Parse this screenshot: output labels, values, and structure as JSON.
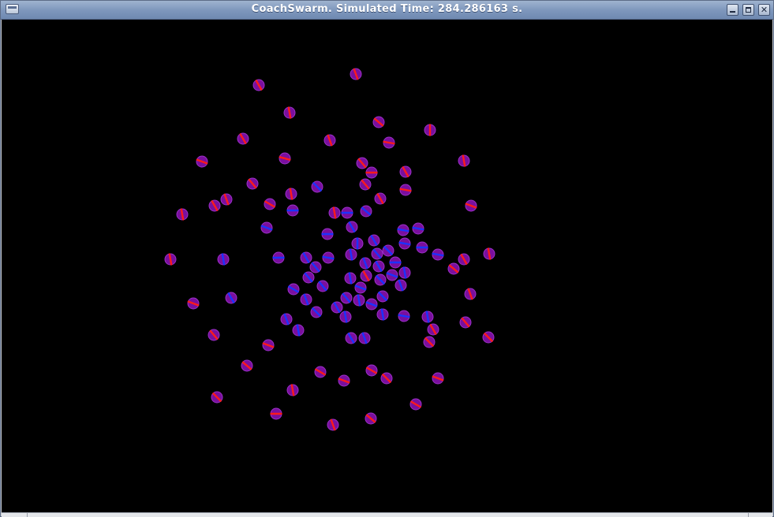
{
  "window": {
    "title": "CoachSwarm. Simulated Time: 284.286163 s.",
    "menu_icon": "window-menu-icon",
    "controls": {
      "minimize_icon": "minimize-icon",
      "maximize_icon": "maximize-icon",
      "close_icon": "close-icon",
      "close_glyph": "✕"
    }
  },
  "simulation": {
    "background_color": "#000000",
    "agent_body_color": "#7a0f9e",
    "agent_stroke_color": "#9b30c8",
    "heading_colors": [
      "#ff1a1a",
      "#1a33ff"
    ]
  }
}
